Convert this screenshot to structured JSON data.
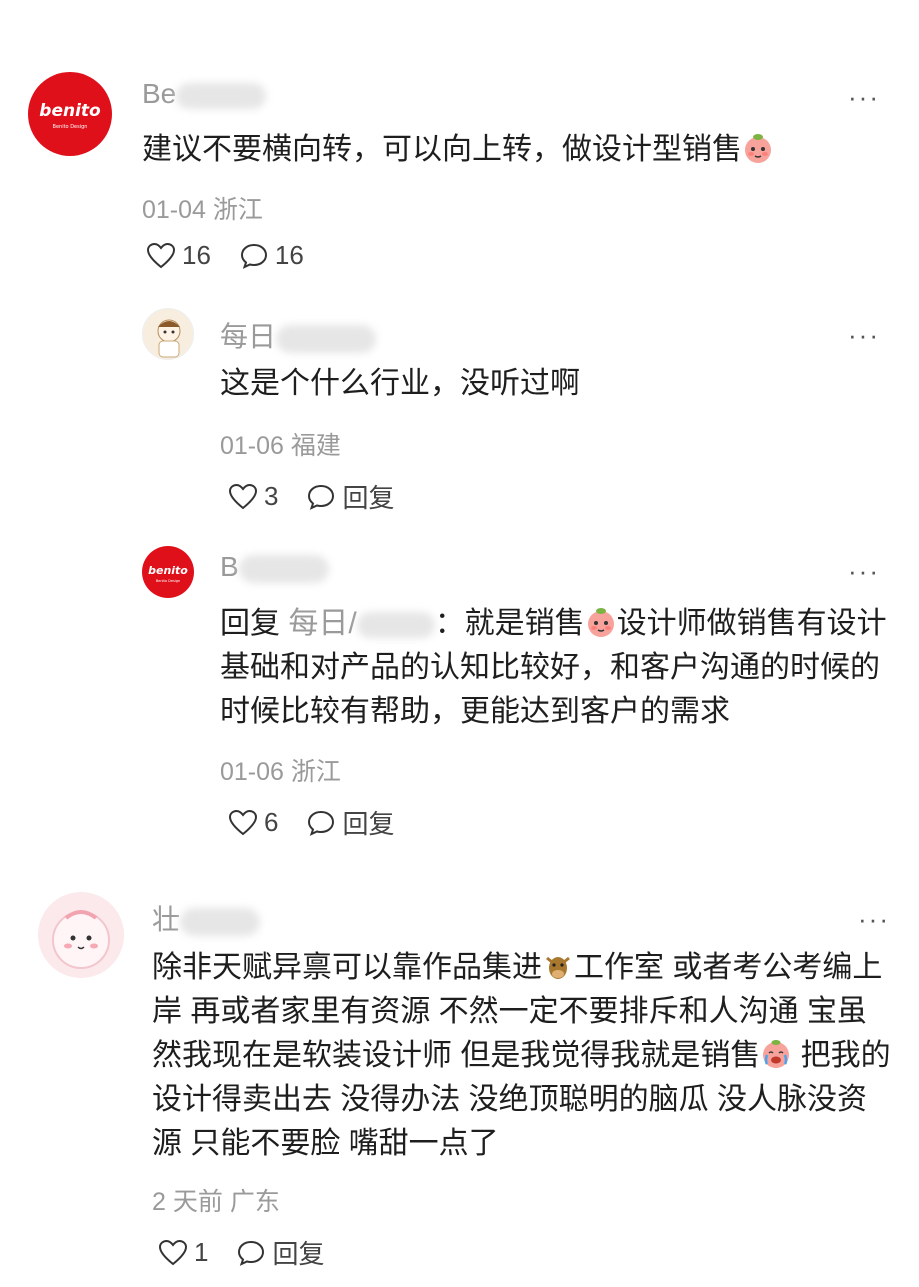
{
  "comments": [
    {
      "name_visible": "Be",
      "text": "建议不要横向转，可以向上转，做设计型销售",
      "date": "01-04",
      "region": "浙江",
      "likes": "16",
      "replies": "16",
      "avatar_text": "benito",
      "avatar_sub": "Benito Design",
      "avatar_color": "#e0101b"
    },
    {
      "name_visible": "每日",
      "text": "这是个什么行业，没听过啊",
      "date": "01-06",
      "region": "福建",
      "likes": "3",
      "replies": "回复"
    },
    {
      "name_visible": "B",
      "reply_prefix": "回复",
      "reply_to": "每日/",
      "text_after": "：就是销售",
      "text_rest": "设计师做销售有设计基础和对产品的认知比较好，和客户沟通的时候的时候比较有帮助，更能达到客户的需求",
      "date": "01-06",
      "region": "浙江",
      "likes": "6",
      "replies": "回复",
      "avatar_text": "benito",
      "avatar_sub": "Benito Design",
      "avatar_color": "#e0101b"
    },
    {
      "name_visible": "壮",
      "text_a": "除非天赋异禀可以靠作品集进",
      "text_b": "工作室 或者考公考编上岸 再或者家里有资源 不然一定不要排斥和人沟通 宝虽然我现在是软装设计师 但是我觉得我就是销售",
      "text_c": " 把我的设计得卖出去 没得办法 没绝顶聪明的脑瓜 没人脉没资源 只能不要脸 嘴甜一点了",
      "date": "2 天前",
      "region": "广东",
      "likes": "1",
      "replies": "回复"
    }
  ],
  "more_label": "···"
}
